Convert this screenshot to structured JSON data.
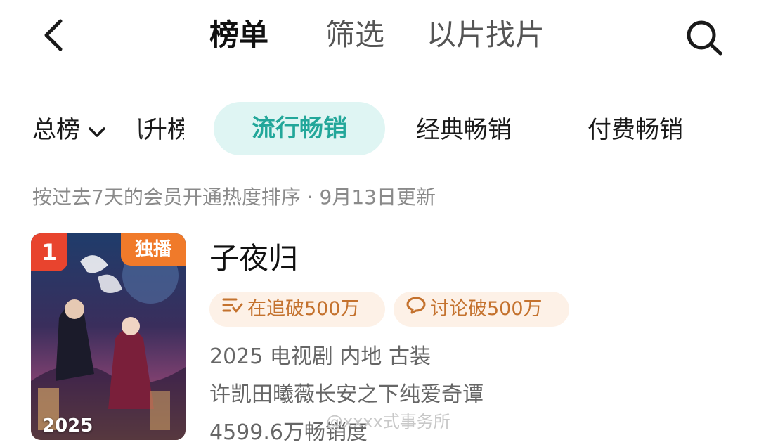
{
  "header": {
    "back_icon": "chevron-left-icon",
    "tabs": [
      {
        "label": "榜单",
        "active": true
      },
      {
        "label": "筛选",
        "active": false
      },
      {
        "label": "以片找片",
        "active": false
      }
    ],
    "search_icon": "search-icon"
  },
  "categories": {
    "first": {
      "label": "总榜",
      "icon": "chevron-down-icon"
    },
    "partial": {
      "label": "飙升榜"
    },
    "items": [
      {
        "label": "流行畅销",
        "active": true
      },
      {
        "label": "经典畅销",
        "active": false
      },
      {
        "label": "付费畅销",
        "active": false
      }
    ]
  },
  "note": "按过去7天的会员开通热度排序 · 9月13日更新",
  "item": {
    "rank": "1",
    "badge": "独播",
    "poster_year": "2025",
    "title": "子夜归",
    "pills": [
      {
        "icon": "list-check-icon",
        "label": "在追破500万"
      },
      {
        "icon": "comment-icon",
        "label": "讨论破500万"
      }
    ],
    "meta_line": "2025 电视剧 内地 古装",
    "description": "许凯田曦薇长安之下纯爱奇谭",
    "sales": "4599.6万畅销度"
  },
  "watermark": "@xxxx式事务所",
  "colors": {
    "accent": "#23a79a",
    "accent_bg": "#dff5f3",
    "rank_red": "#e8442e",
    "badge_orange": "#f07a2a",
    "pill_bg": "#fdf1e7",
    "pill_text": "#c4722e"
  }
}
